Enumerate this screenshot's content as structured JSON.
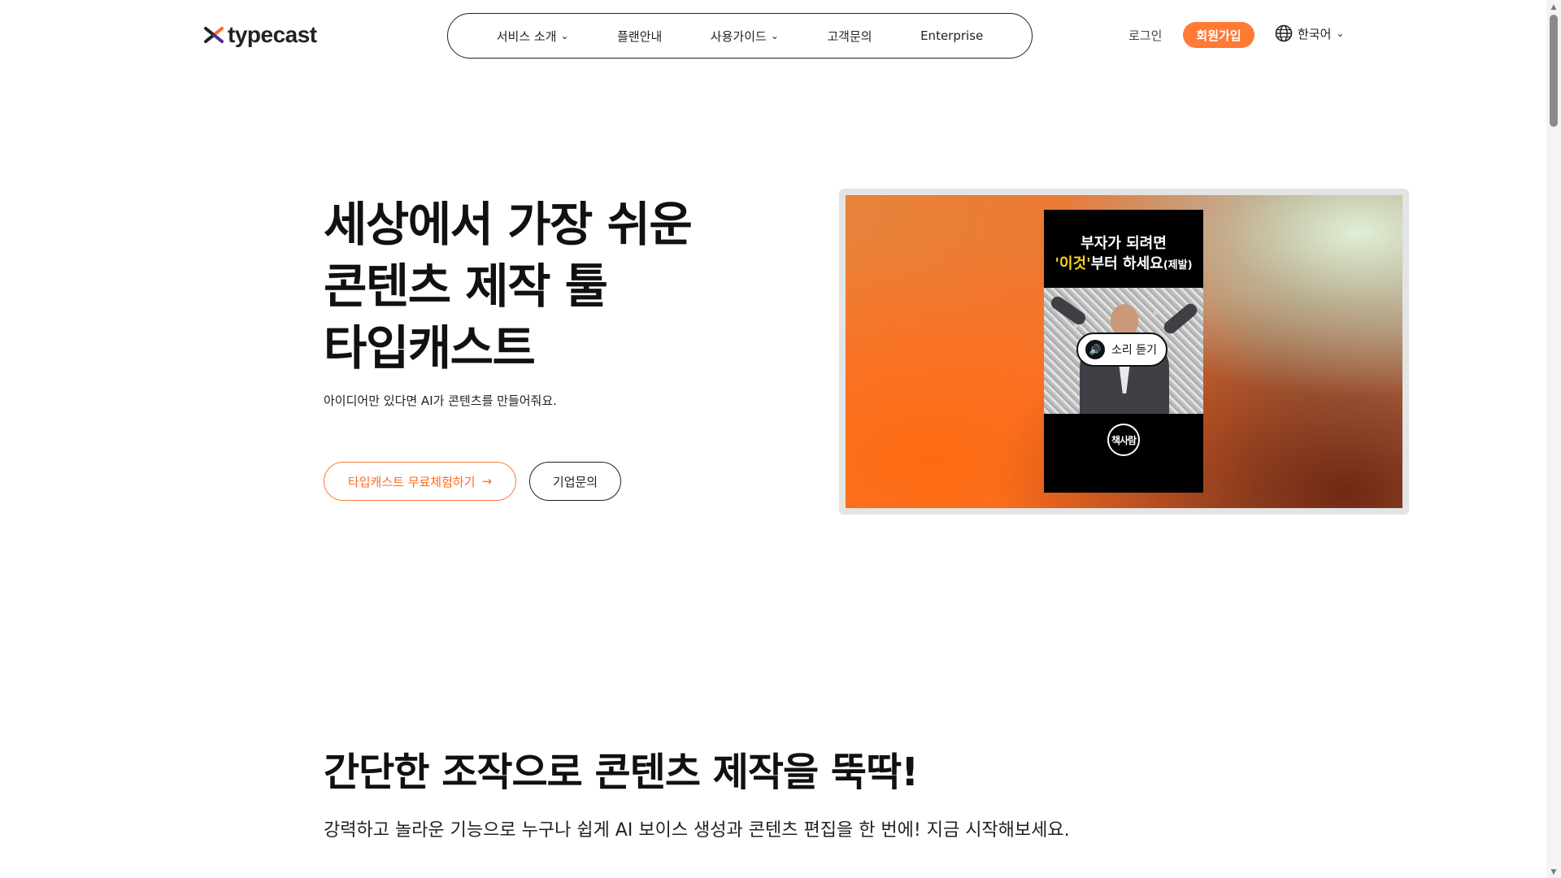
{
  "header": {
    "logo_text": "typecast",
    "nav": [
      {
        "label": "서비스 소개",
        "has_dropdown": true
      },
      {
        "label": "플랜안내",
        "has_dropdown": false
      },
      {
        "label": "사용가이드",
        "has_dropdown": true
      },
      {
        "label": "고객문의",
        "has_dropdown": false
      },
      {
        "label": "Enterprise",
        "has_dropdown": false
      }
    ],
    "login_label": "로그인",
    "signup_label": "회원가입",
    "language_label": "한국어"
  },
  "hero": {
    "title_lines": [
      "세상에서 가장 쉬운",
      "콘텐츠 제작 툴",
      "타입캐스트"
    ],
    "subtitle": "아이디어만 있다면 AI가 콘텐츠를 만들어줘요.",
    "cta_primary": "타입캐스트 무료체험하기",
    "cta_primary_arrow": "→",
    "cta_secondary": "기업문의"
  },
  "video": {
    "caption_line1": "부자가 되려면",
    "caption_highlight": "'이것'",
    "caption_rest": "부터 하세요",
    "caption_small": "(제발)",
    "sound_label": "소리 듣기",
    "channel_badge": "책사람"
  },
  "section2": {
    "title": "간단한 조작으로 콘텐츠 제작을 뚝딱!",
    "subtitle": "강력하고 놀라운 기능으로 누구나 쉽게 AI 보이스 생성과 콘텐츠 편집을 한 번에! 지금 시작해보세요."
  },
  "colors": {
    "accent": "#ff7a35",
    "text": "#111111",
    "highlight": "#ffd21a"
  }
}
